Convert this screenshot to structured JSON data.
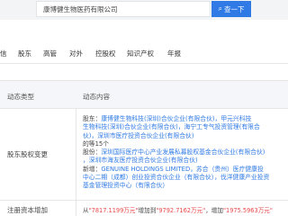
{
  "search": {
    "value": "康博健生物医药有限公司",
    "button_label": "查一下"
  },
  "nav": {
    "items": [
      "信",
      "股东",
      "高管",
      "对外",
      "控股权",
      "知识产权",
      "年报"
    ]
  },
  "table": {
    "headers": [
      "动态类型",
      "动态内容"
    ],
    "rows": [
      {
        "type": "股东股权变更",
        "lines": [
          [
            {
              "text": "股东：",
              "link": false
            },
            {
              "text": "康博健生物科技(深圳)合伙企业(有限合伙)，甲元兴科技",
              "link": true
            }
          ],
          [
            {
              "text": "生物科技(深圳)合伙企业(有限合伙)，海宁工专气投资管理(有限合",
              "link": true
            }
          ],
          [
            {
              "text": "伙)，深圳市医疗投资合伙企业(有限合伙)",
              "link": true
            }
          ],
          [
            {
              "text": "的等15个",
              "link": false
            }
          ],
          [
            {
              "text": "股份：",
              "link": false
            },
            {
              "text": "深圳国际医疗中心产业发展私募股权基金合伙企业(有限合伙)",
              "link": true
            }
          ],
          [
            {
              "text": "，深圳市海友医疗投资合伙企业(有限合伙)",
              "link": true
            }
          ],
          [
            {
              "text": "新增：",
              "link": false
            },
            {
              "text": "GENUINE HOLDINGS LIMITED，苏合（贵州）医疗健康投",
              "link": true
            }
          ],
          [
            {
              "text": "中心二期（成都）创业投资合伙企业（有限合伙），伐洋健康产业投资",
              "link": true
            }
          ],
          [
            {
              "text": "基金管理投资中心（有限合伙）",
              "link": true
            }
          ]
        ]
      },
      {
        "type": "注册资本增加",
        "parts": [
          {
            "text": "从",
            "red": false
          },
          {
            "text": "\"7817.1199万元\"",
            "red": true
          },
          {
            "text": "增加到",
            "red": false
          },
          {
            "text": "\"9792.7162万元\"",
            "red": true
          },
          {
            "text": "，增加",
            "red": false
          },
          {
            "text": "\"1975.5963万元\"",
            "red": true
          }
        ]
      }
    ]
  },
  "colors": {
    "accent": "#2f7ae5",
    "highlight": "#e84a4a",
    "header_bg": "#f4f6f9",
    "top_band": "#f3f4f6"
  },
  "icons": {
    "search_button": "search-icon"
  }
}
